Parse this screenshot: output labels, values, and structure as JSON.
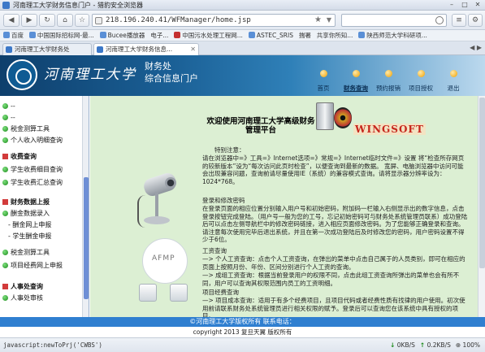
{
  "browser": {
    "window_title": "河南理工大学财务信息门户 - 猎豹安全浏览器",
    "nav_back": "◀",
    "nav_forward": "▶",
    "nav_reload": "↻",
    "nav_home": "⌂",
    "address": "218.196.240.41/WFManager/home.jsp",
    "bookmarks": [
      "百度",
      "中国国际招标网-最...",
      "Bucee播放器",
      "电子...",
      "中国污水处理工程网...",
      "ASTEC_SRIS",
      "揣署",
      "共享你所知...",
      "陕西师范大学科研项..."
    ],
    "tabs": [
      {
        "label": "河南理工大学财务处",
        "active": false
      },
      {
        "label": "河南理工大学财务信息...",
        "active": true
      }
    ]
  },
  "header": {
    "university": "河南理工大学",
    "department": "财务处",
    "portal": "综合信息门户",
    "nav": [
      {
        "label": "首页",
        "active": false
      },
      {
        "label": "财务查询",
        "active": true
      },
      {
        "label": "预约报销",
        "active": false
      },
      {
        "label": "项目授权",
        "active": false
      },
      {
        "label": "退出",
        "active": false
      }
    ]
  },
  "sidebar": {
    "items": [
      {
        "label": "--",
        "kind": "bullet"
      },
      {
        "label": "--",
        "kind": "bullet"
      },
      {
        "label": "税金测算工具",
        "kind": "bullet"
      },
      {
        "label": "个人收入明细查询",
        "kind": "bullet"
      },
      {
        "label": "收费查询",
        "kind": "head"
      },
      {
        "label": "学生收费细目查询",
        "kind": "bullet"
      },
      {
        "label": "学生收费汇总查询",
        "kind": "bullet"
      },
      {
        "label": "财务数据上报",
        "kind": "head"
      },
      {
        "label": "酬金数据录入",
        "kind": "bullet"
      },
      {
        "label": "- 酬金网上申报",
        "kind": "sub"
      },
      {
        "label": "- 学生酬金申报",
        "kind": "sub"
      },
      {
        "label": "税金测算工具",
        "kind": "bullet"
      },
      {
        "label": "项目经费网上申报",
        "kind": "bullet"
      },
      {
        "label": "人事处查询",
        "kind": "head"
      },
      {
        "label": "人事处审核",
        "kind": "bullet"
      }
    ]
  },
  "content": {
    "welcome": "欢迎使用河南理工大学高级财务管理平台",
    "wingsoft": "WINGSOFT",
    "afmp": "AFMP",
    "paragraphs": [
      {
        "text": "特别注意：",
        "indent": true
      },
      {
        "text": "请在浏览器中=》工具=》Internet选项=》常规=》Internet临时文件=》设置 将“检查所存网页的较新版本”设为“每次访问此页时检查”，以便查询到最新的数据。 宽屏、电脑浏览器中访问可能会出现兼容问题，查询前请尽量使用IE（系统）的兼容模式查询。请将显示器分辨率设为：1024*768。",
        "indent": false
      },
      {
        "text": "登录和修改密码",
        "indent": false
      },
      {
        "text": "在登录页面的相应位置分别输入用户号和初始密码，附加码一栏输入右侧显示出的数字信息，点击登录按钮完成登陆。（用户号一般为您的工号，忘记初始密码可与财务处系统管理员联系）成功登陆后可以点击左侧导航栏中的修改密码链接，进入相应页面修改密码。为了您能够正确登录和查询。请注意每次使用完毕后退出系统，并且在第一次成功登陆后及时修改您的密码，用户密码设置不得少于6位。",
        "indent": false
      },
      {
        "text": "工资查询",
        "indent": false
      },
      {
        "text": "—> 个人工资查询：点击个人工资查询，在弹出的菜单中点击自己属于的人员类别，即可在相应的页面上按照月份、年份、区间分别进行个人工资的查询。",
        "indent": false
      },
      {
        "text": "—> 成组工资查询：根据当前登录用户的权限不同，点击此组工资查询所弹出的菜单也会有所不同，用户可以查询其权限范围内员工的工资明细。",
        "indent": false
      },
      {
        "text": "项目经费查询",
        "indent": false
      },
      {
        "text": "—> 项目成本查询：适用于有多个经费项目，且项目代码或者经费性质有找律的用户使用。初次使用前请联系财务处系统管理员进行相关权限的赋予。登录后可以查询您在该系统中具有授权的项目。",
        "indent": false
      }
    ]
  },
  "footer": {
    "bar_text": "©河南理工大学版权所有  联系电话：",
    "copyright": "copyright 2013 复旦天翼 版权所有"
  },
  "statusbar": {
    "left": "javascript:newToPrj('CWBS')",
    "down": "0KB/S",
    "up": "0.2KB/S",
    "zoom": "100%"
  },
  "colors": {
    "header_dark": "#0e3f6c",
    "content_bg": "#dcefd3",
    "footer_blue": "#2f7fd0",
    "wingsoft_red": "#c6261c"
  }
}
